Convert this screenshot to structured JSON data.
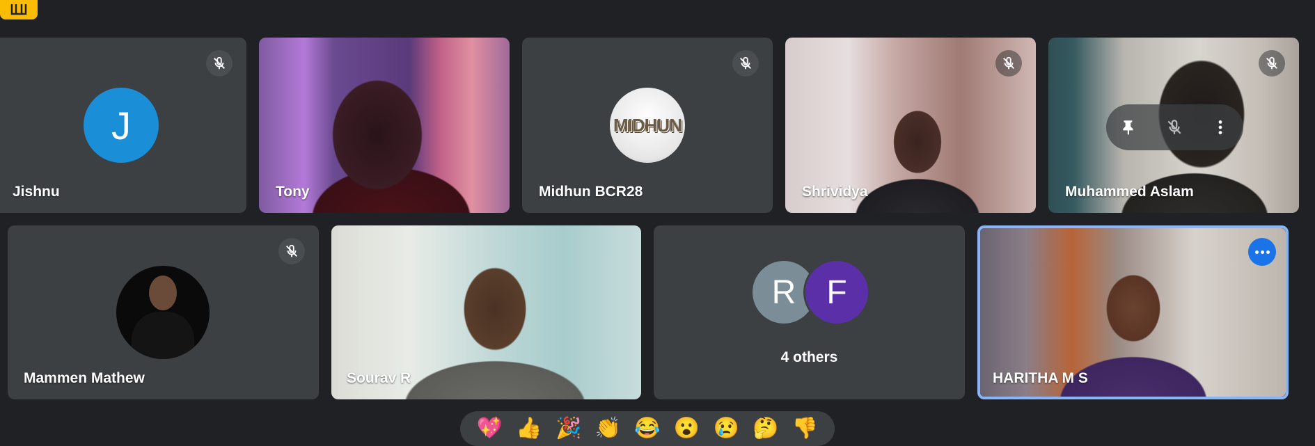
{
  "participants": [
    {
      "name": "Jishnu",
      "initial": "J",
      "muted": true,
      "avatar_color": "#1a8fd8"
    },
    {
      "name": "Tony",
      "muted": false
    },
    {
      "name": "Midhun BCR28",
      "avatar_text": "MIDHUN",
      "muted": true
    },
    {
      "name": "Shrividya",
      "muted": true
    },
    {
      "name": "Muhammed Aslam",
      "muted": true
    },
    {
      "name": "Mammen Mathew",
      "muted": true
    },
    {
      "name": "Sourav R",
      "muted": false
    },
    {
      "name": "HARITHA M S",
      "muted": false,
      "active_speaker": true
    }
  ],
  "others_tile": {
    "avatars": [
      {
        "initial": "R",
        "color": "#7b8e98"
      },
      {
        "initial": "F",
        "color": "#5b2fa8"
      }
    ],
    "label": "4 others"
  },
  "hover_controls": [
    "pin-icon",
    "mic-off-icon",
    "more-vert-icon"
  ],
  "reactions": [
    "💖",
    "👍",
    "🎉",
    "👏",
    "😂",
    "😮",
    "😢",
    "🤔",
    "👎"
  ],
  "colors": {
    "background": "#202124",
    "tile": "#3c4043",
    "active_border": "#8ab4f8",
    "accent_blue": "#1a73e8",
    "corner_button": "#fbbc04"
  }
}
